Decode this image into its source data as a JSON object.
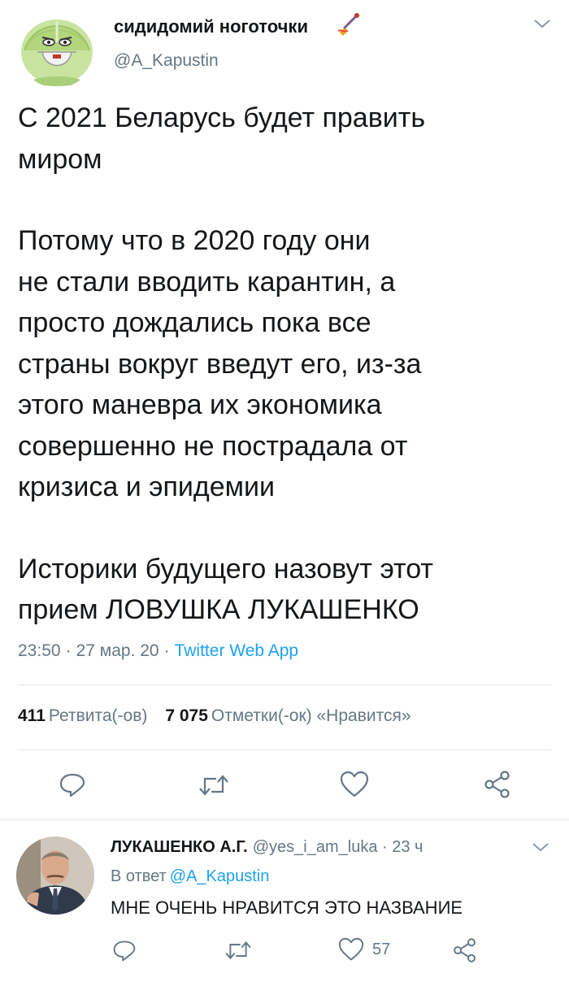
{
  "tweet": {
    "author_name": "сидидомий ноготочки",
    "author_handle": "@A_Kapustin",
    "paragraphs": [
      "С 2021 Беларусь будет править\nмиром",
      "Потому что в 2020 году они\nне стали вводить карантин, а\nпросто дождались пока все\nстраны вокруг введут его, из-за\nэтого маневра их экономика\nсовершенно не пострадала от\nкризиса и эпидемии",
      "Историки будущего назовут этот\nприем ЛОВУШКА ЛУКАШЕНКО"
    ],
    "time": "23:50",
    "date": "27 мар. 20",
    "separator": "·",
    "source": "Twitter Web App",
    "retweets_count": "411",
    "retweets_label": "Ретвита(-ов)",
    "likes_count": "7 075",
    "likes_label": "Отметки(-ок) «Нравится»"
  },
  "reply": {
    "author_name": "ЛУКАШЕНКО А.Г.",
    "author_handle": "@yes_i_am_luka",
    "separator": "·",
    "time": "23 ч",
    "reply_to_label": "В ответ",
    "reply_to_handle": "@A_Kapustin",
    "text": "МНЕ ОЧЕНЬ НРАВИТСЯ ЭТО НАЗВАНИЕ",
    "likes_count": "57"
  },
  "icons": {
    "reply": "reply-icon",
    "retweet": "retweet-icon",
    "like": "heart-icon",
    "share": "share-icon",
    "menu": "chevron-down-icon",
    "name_emoji": "nail-polish-emoji-icon"
  },
  "colors": {
    "text_primary": "#14171a",
    "text_secondary": "#657786",
    "link": "#1da1f2",
    "divider": "#e1e8ed",
    "icon": "#657786"
  }
}
